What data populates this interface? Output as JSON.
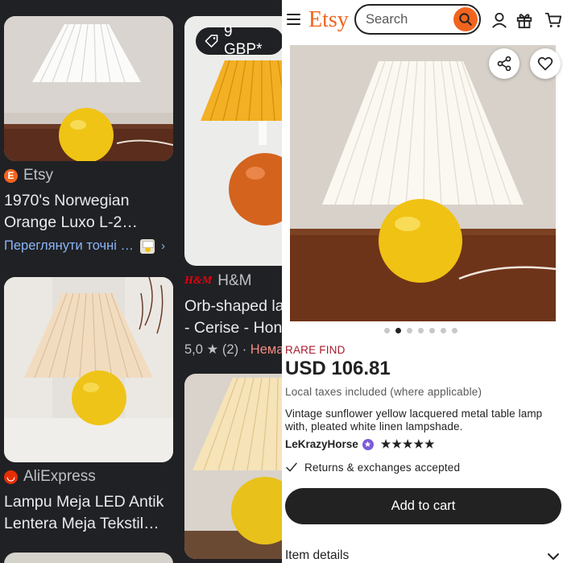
{
  "results": [
    {
      "source": "Etsy",
      "title_line1": "1970's Norwegian",
      "title_line2": "Orange Luxo L-2…",
      "similar_text": "Переглянути точні …"
    },
    {
      "source": "H&M",
      "price_badge": "9 GBP*",
      "title_line1": "Orb-shaped la",
      "title_line2": "- Cerise - Hon",
      "rating_value": "5,0",
      "rating_count": "(2)",
      "stock_status": "Нема"
    },
    {
      "source": "AliExpress",
      "title_line1": "Lampu Meja LED Antik",
      "title_line2": "Lentera Meja Tekstil…"
    }
  ],
  "etsy": {
    "logo": "Etsy",
    "search_placeholder": "Search",
    "badge": "RARE FIND",
    "price": "USD 106.81",
    "tax_note": "Local taxes included (where applicable)",
    "description": "Vintage sunflower yellow lacquered metal table lamp with, pleated white linen lampshade.",
    "seller": "LeKrazyHorse",
    "seller_rating": 5,
    "stars": "★★★★★",
    "returns": "Returns & exchanges accepted",
    "add_to_cart": "Add to cart",
    "item_details": "Item details",
    "gallery_total": 7,
    "gallery_active": 2
  },
  "colors": {
    "etsy_orange": "#f1641e",
    "dark_bg": "#202124",
    "link_blue": "#8ab4f8",
    "rare_red": "#a61a2e",
    "button_dark": "#222222"
  },
  "icons": [
    "hamburger-icon",
    "search-icon",
    "user-icon",
    "gift-icon",
    "cart-icon",
    "share-icon",
    "heart-icon",
    "check-icon",
    "chevron-down-icon",
    "tag-icon",
    "chevron-right-icon",
    "star-icon"
  ]
}
